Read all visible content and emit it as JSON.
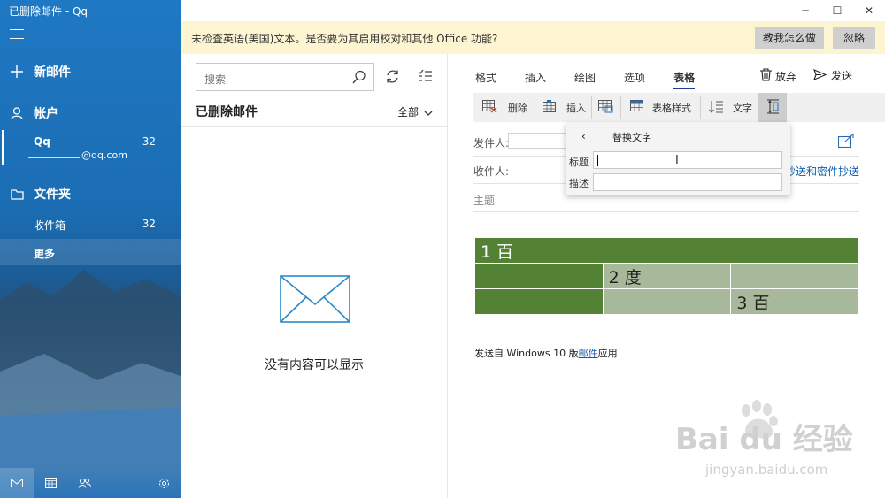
{
  "window": {
    "title": "已删除邮件 - Qq",
    "minimize_label": "─",
    "maximize_label": "☐",
    "close_label": "✕"
  },
  "sidebar": {
    "new_mail": "新邮件",
    "accounts_label": "帐户",
    "account_name": "Qq",
    "account_count": "32",
    "account_email": "@qq.com",
    "folders_label": "文件夹",
    "inbox_label": "收件箱",
    "inbox_count": "32",
    "more_label": "更多",
    "bottom_icons": [
      "mail-icon",
      "calendar-icon",
      "people-icon",
      "settings-icon"
    ]
  },
  "notification": {
    "message": "未检查英语(美国)文本。是否要为其启用校对和其他 Office 功能?",
    "show_me_label": "教我怎么做",
    "ignore_label": "忽略"
  },
  "list": {
    "search_placeholder": "搜索",
    "folder_title": "已删除邮件",
    "filter_label": "全部",
    "empty_text": "没有内容可以显示"
  },
  "compose": {
    "tabs": [
      {
        "label": "格式",
        "active": false
      },
      {
        "label": "插入",
        "active": false
      },
      {
        "label": "绘图",
        "active": false
      },
      {
        "label": "选项",
        "active": false
      },
      {
        "label": "表格",
        "active": true
      }
    ],
    "discard_label": "放弃",
    "send_label": "发送",
    "ribbon": {
      "delete_label": "删除",
      "insert_label": "插入",
      "table_style_label": "表格样式",
      "text_label": "文字"
    },
    "from_label": "发件人:",
    "to_label": "收件人:",
    "cc_bcc_label": "抄送和密件抄送",
    "subject_placeholder": "主题",
    "alt_text": {
      "header": "替换文字",
      "title_label": "标题",
      "description_label": "描述",
      "title_value": "",
      "description_value": ""
    },
    "table": {
      "rows": [
        [
          "1 百",
          "",
          ""
        ],
        [
          "",
          "2 度",
          ""
        ],
        [
          "",
          "",
          "3 百"
        ]
      ]
    },
    "signature_prefix": "发送自 Windows 10 版",
    "signature_link": "邮件",
    "signature_suffix": "应用"
  },
  "watermark": {
    "brand": "Bai du 经验",
    "url": "jingyan.baidu.com"
  },
  "colors": {
    "sidebar_blue": "#1f78c3",
    "notify_bg": "#fdf5d2",
    "table_dark": "#548235",
    "table_light": "#a8b99b",
    "link": "#0b5cad"
  }
}
